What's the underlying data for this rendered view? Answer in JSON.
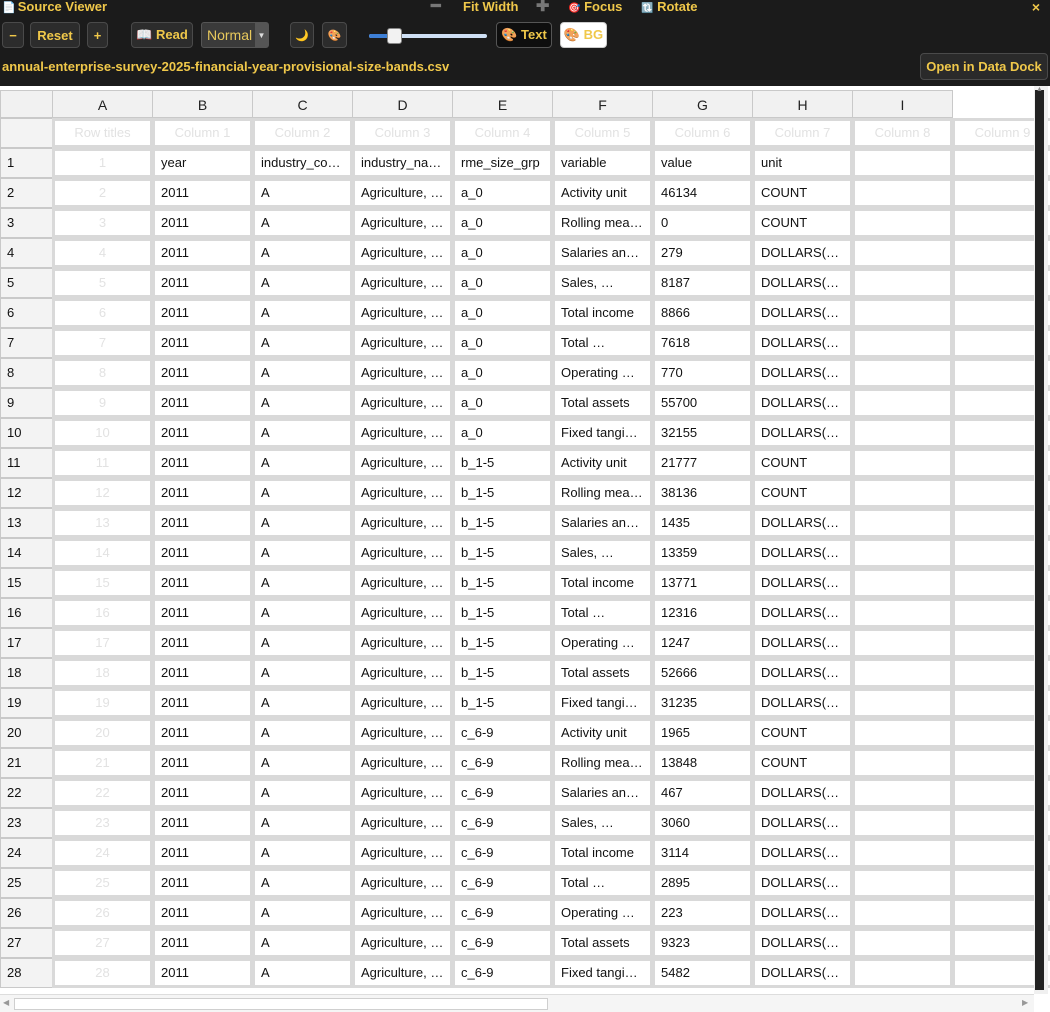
{
  "window": {
    "title": "Source Viewer",
    "fit_width": "Fit Width",
    "focus": "Focus",
    "rotate": "Rotate",
    "close": "×"
  },
  "toolbar": {
    "zoom_out": "−",
    "reset": "Reset",
    "zoom_in": "+",
    "read": "📖 Read",
    "mode_value": "Normal",
    "dark_icon": "🌙",
    "palette_icon": "🎨",
    "text_btn": "🎨 Text",
    "bg_btn": "🎨 BG",
    "slider_percent": 20
  },
  "file": {
    "name": "annual-enterprise-survey-2025-financial-year-provisional-size-bands.csv",
    "open_dock": "Open in Data Dock"
  },
  "sheet": {
    "col_letters": [
      "A",
      "B",
      "C",
      "D",
      "E",
      "F",
      "G",
      "H",
      "I"
    ],
    "title_row": [
      "Row titles",
      "Column 1",
      "Column 2",
      "Column 3",
      "Column 4",
      "Column 5",
      "Column 6",
      "Column 7",
      "Column 8",
      "Column 9"
    ],
    "rows": [
      [
        "year",
        "industry_co…",
        "industry_na…",
        "rme_size_grp",
        "variable",
        "value",
        "unit",
        "",
        ""
      ],
      [
        "2011",
        "A",
        "Agriculture, …",
        "a_0",
        "Activity unit",
        "46134",
        "COUNT",
        "",
        ""
      ],
      [
        "2011",
        "A",
        "Agriculture, …",
        "a_0",
        "Rolling mea…",
        "0",
        "COUNT",
        "",
        ""
      ],
      [
        "2011",
        "A",
        "Agriculture, …",
        "a_0",
        "Salaries an…",
        "279",
        "DOLLARS(…",
        "",
        ""
      ],
      [
        "2011",
        "A",
        "Agriculture, …",
        "a_0",
        "Sales, …",
        "8187",
        "DOLLARS(…",
        "",
        ""
      ],
      [
        "2011",
        "A",
        "Agriculture, …",
        "a_0",
        "Total income",
        "8866",
        "DOLLARS(…",
        "",
        ""
      ],
      [
        "2011",
        "A",
        "Agriculture, …",
        "a_0",
        "Total …",
        "7618",
        "DOLLARS(…",
        "",
        ""
      ],
      [
        "2011",
        "A",
        "Agriculture, …",
        "a_0",
        "Operating …",
        "770",
        "DOLLARS(…",
        "",
        ""
      ],
      [
        "2011",
        "A",
        "Agriculture, …",
        "a_0",
        "Total assets",
        "55700",
        "DOLLARS(…",
        "",
        ""
      ],
      [
        "2011",
        "A",
        "Agriculture, …",
        "a_0",
        "Fixed tangi…",
        "32155",
        "DOLLARS(…",
        "",
        ""
      ],
      [
        "2011",
        "A",
        "Agriculture, …",
        "b_1-5",
        "Activity unit",
        "21777",
        "COUNT",
        "",
        ""
      ],
      [
        "2011",
        "A",
        "Agriculture, …",
        "b_1-5",
        "Rolling mea…",
        "38136",
        "COUNT",
        "",
        ""
      ],
      [
        "2011",
        "A",
        "Agriculture, …",
        "b_1-5",
        "Salaries an…",
        "1435",
        "DOLLARS(…",
        "",
        ""
      ],
      [
        "2011",
        "A",
        "Agriculture, …",
        "b_1-5",
        "Sales, …",
        "13359",
        "DOLLARS(…",
        "",
        ""
      ],
      [
        "2011",
        "A",
        "Agriculture, …",
        "b_1-5",
        "Total income",
        "13771",
        "DOLLARS(…",
        "",
        ""
      ],
      [
        "2011",
        "A",
        "Agriculture, …",
        "b_1-5",
        "Total …",
        "12316",
        "DOLLARS(…",
        "",
        ""
      ],
      [
        "2011",
        "A",
        "Agriculture, …",
        "b_1-5",
        "Operating …",
        "1247",
        "DOLLARS(…",
        "",
        ""
      ],
      [
        "2011",
        "A",
        "Agriculture, …",
        "b_1-5",
        "Total assets",
        "52666",
        "DOLLARS(…",
        "",
        ""
      ],
      [
        "2011",
        "A",
        "Agriculture, …",
        "b_1-5",
        "Fixed tangi…",
        "31235",
        "DOLLARS(…",
        "",
        ""
      ],
      [
        "2011",
        "A",
        "Agriculture, …",
        "c_6-9",
        "Activity unit",
        "1965",
        "COUNT",
        "",
        ""
      ],
      [
        "2011",
        "A",
        "Agriculture, …",
        "c_6-9",
        "Rolling mea…",
        "13848",
        "COUNT",
        "",
        ""
      ],
      [
        "2011",
        "A",
        "Agriculture, …",
        "c_6-9",
        "Salaries an…",
        "467",
        "DOLLARS(…",
        "",
        ""
      ],
      [
        "2011",
        "A",
        "Agriculture, …",
        "c_6-9",
        "Sales, …",
        "3060",
        "DOLLARS(…",
        "",
        ""
      ],
      [
        "2011",
        "A",
        "Agriculture, …",
        "c_6-9",
        "Total income",
        "3114",
        "DOLLARS(…",
        "",
        ""
      ],
      [
        "2011",
        "A",
        "Agriculture, …",
        "c_6-9",
        "Total …",
        "2895",
        "DOLLARS(…",
        "",
        ""
      ],
      [
        "2011",
        "A",
        "Agriculture, …",
        "c_6-9",
        "Operating …",
        "223",
        "DOLLARS(…",
        "",
        ""
      ],
      [
        "2011",
        "A",
        "Agriculture, …",
        "c_6-9",
        "Total assets",
        "9323",
        "DOLLARS(…",
        "",
        ""
      ],
      [
        "2011",
        "A",
        "Agriculture, …",
        "c_6-9",
        "Fixed tangi…",
        "5482",
        "DOLLARS(…",
        "",
        ""
      ]
    ]
  }
}
